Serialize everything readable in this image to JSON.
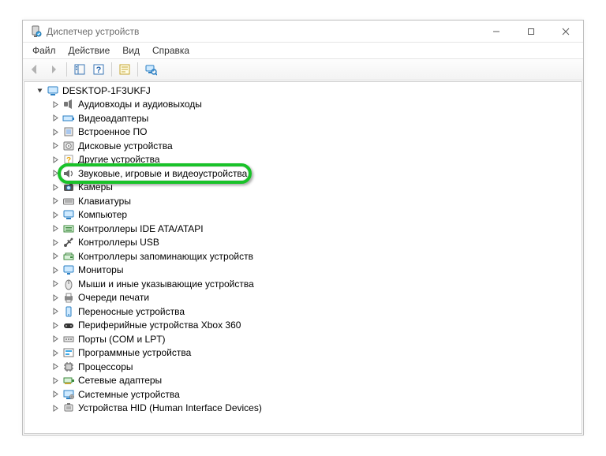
{
  "window": {
    "title": "Диспетчер устройств"
  },
  "menu": {
    "items": [
      "Файл",
      "Действие",
      "Вид",
      "Справка"
    ]
  },
  "tree": {
    "root": {
      "label": "DESKTOP-1F3UKFJ",
      "icon": "computer-icon"
    },
    "children": [
      {
        "icon": "audio-io-icon",
        "label": "Аудиовходы и аудиовыходы"
      },
      {
        "icon": "video-adapter-icon",
        "label": "Видеоадаптеры"
      },
      {
        "icon": "firmware-icon",
        "label": "Встроенное ПО"
      },
      {
        "icon": "disk-icon",
        "label": "Дисковые устройства"
      },
      {
        "icon": "other-devices-icon",
        "label": "Другие устройства"
      },
      {
        "icon": "sound-icon",
        "label": "Звуковые, игровые и видеоустройства",
        "highlighted": true
      },
      {
        "icon": "camera-icon",
        "label": "Камеры"
      },
      {
        "icon": "keyboard-icon",
        "label": "Клавиатуры"
      },
      {
        "icon": "computer-icon",
        "label": "Компьютер"
      },
      {
        "icon": "ide-controller-icon",
        "label": "Контроллеры IDE ATA/ATAPI"
      },
      {
        "icon": "usb-controller-icon",
        "label": "Контроллеры USB"
      },
      {
        "icon": "storage-controller-icon",
        "label": "Контроллеры запоминающих устройств"
      },
      {
        "icon": "monitor-icon",
        "label": "Мониторы"
      },
      {
        "icon": "mouse-icon",
        "label": "Мыши и иные указывающие устройства"
      },
      {
        "icon": "print-queue-icon",
        "label": "Очереди печати"
      },
      {
        "icon": "portable-device-icon",
        "label": "Переносные устройства"
      },
      {
        "icon": "xbox-icon",
        "label": "Периферийные устройства Xbox 360"
      },
      {
        "icon": "ports-icon",
        "label": "Порты (COM и LPT)"
      },
      {
        "icon": "software-device-icon",
        "label": "Программные устройства"
      },
      {
        "icon": "processor-icon",
        "label": "Процессоры"
      },
      {
        "icon": "network-adapter-icon",
        "label": "Сетевые адаптеры"
      },
      {
        "icon": "system-device-icon",
        "label": "Системные устройства"
      },
      {
        "icon": "hid-icon",
        "label": "Устройства HID (Human Interface Devices)"
      }
    ]
  },
  "colors": {
    "highlight": "#19c229"
  }
}
